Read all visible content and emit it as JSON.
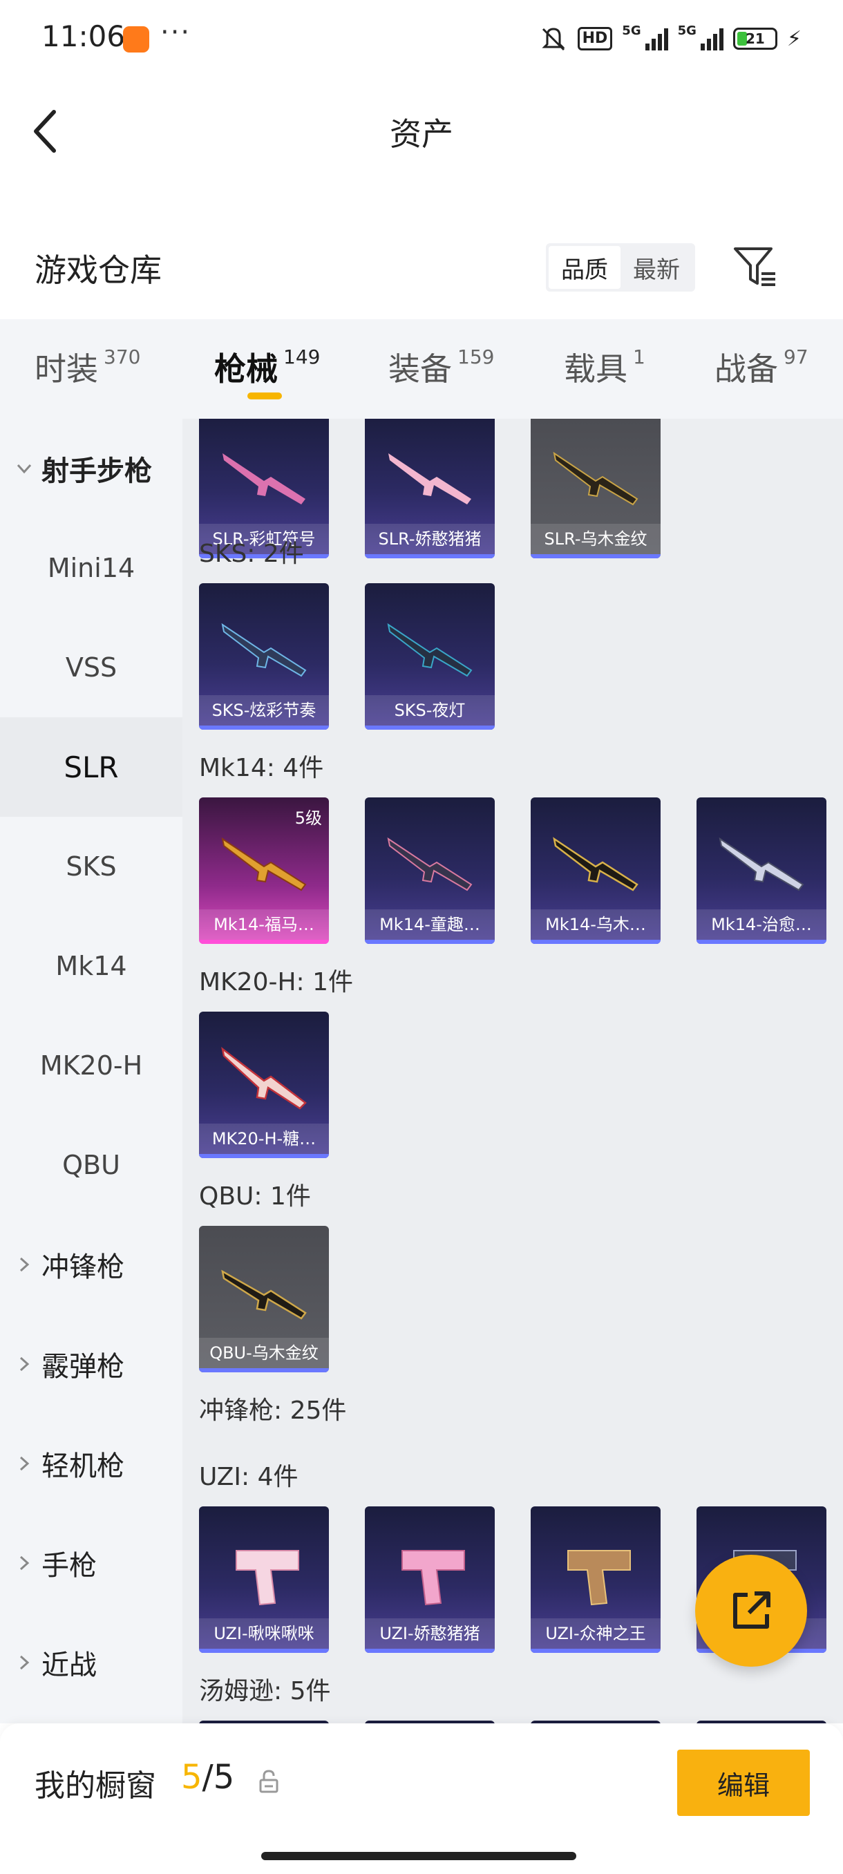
{
  "status_bar": {
    "time": "11:06",
    "more": "···",
    "hd_label": "HD",
    "net1": "5G",
    "net2": "5G",
    "battery": "21",
    "bolt": "⚡"
  },
  "header": {
    "title": "资产"
  },
  "warehouse": {
    "title": "游戏仓库",
    "sort_options": [
      "品质",
      "最新"
    ],
    "active_sort": "品质"
  },
  "tabs": [
    {
      "label": "时装",
      "count": "370"
    },
    {
      "label": "枪械",
      "count": "149"
    },
    {
      "label": "装备",
      "count": "159"
    },
    {
      "label": "载具",
      "count": "1"
    },
    {
      "label": "战备",
      "count": "97"
    }
  ],
  "sidebar": {
    "groups": [
      {
        "label": "射手步枪"
      },
      {
        "label": "冲锋枪"
      },
      {
        "label": "霰弹枪"
      },
      {
        "label": "轻机枪"
      },
      {
        "label": "手枪"
      },
      {
        "label": "近战"
      }
    ],
    "subitems": [
      {
        "label": "Mini14"
      },
      {
        "label": "VSS"
      },
      {
        "label": "SLR"
      },
      {
        "label": "SKS"
      },
      {
        "label": "Mk14"
      },
      {
        "label": "MK20-H"
      },
      {
        "label": "QBU"
      }
    ],
    "active_subitem": "SLR"
  },
  "content": {
    "sections": [
      {
        "label": "",
        "items": [
          {
            "name": "SLR-彩虹符号",
            "style": "purple"
          },
          {
            "name": "SLR-娇憨猪猪",
            "style": "purple"
          },
          {
            "name": "SLR-乌木金纹",
            "style": "gray"
          }
        ]
      },
      {
        "label": "SKS: 2件",
        "items": [
          {
            "name": "SKS-炫彩节奏",
            "style": "purple"
          },
          {
            "name": "SKS-夜灯",
            "style": "purple"
          }
        ]
      },
      {
        "label": "Mk14: 4件",
        "items": [
          {
            "name": "Mk14-福马…",
            "style": "pink",
            "level": "5级"
          },
          {
            "name": "Mk14-童趣…",
            "style": "purple"
          },
          {
            "name": "Mk14-乌木…",
            "style": "purple"
          },
          {
            "name": "Mk14-治愈…",
            "style": "purple"
          }
        ]
      },
      {
        "label": "MK20-H: 1件",
        "items": [
          {
            "name": "MK20-H-糖…",
            "style": "purple"
          }
        ]
      },
      {
        "label": "QBU: 1件",
        "items": [
          {
            "name": "QBU-乌木金纹",
            "style": "gray"
          }
        ]
      },
      {
        "label": "冲锋枪: 25件",
        "items": []
      },
      {
        "label": "UZI: 4件",
        "items": [
          {
            "name": "UZI-啾咪啾咪",
            "style": "purple"
          },
          {
            "name": "UZI-娇憨猪猪",
            "style": "purple"
          },
          {
            "name": "UZI-众神之王",
            "style": "purple"
          },
          {
            "name": "",
            "style": "purple"
          }
        ]
      },
      {
        "label": "汤姆逊: 5件",
        "items": []
      }
    ]
  },
  "bottom": {
    "showcase_label": "我的橱窗",
    "count_current": "5",
    "count_sep": "/",
    "count_total": "5",
    "edit_label": "编辑"
  },
  "colors": {
    "accent": "#f7b500",
    "purple_card": "#2c2a63",
    "gray_card": "#5d5e64",
    "pink_card": "#e14ec2"
  }
}
